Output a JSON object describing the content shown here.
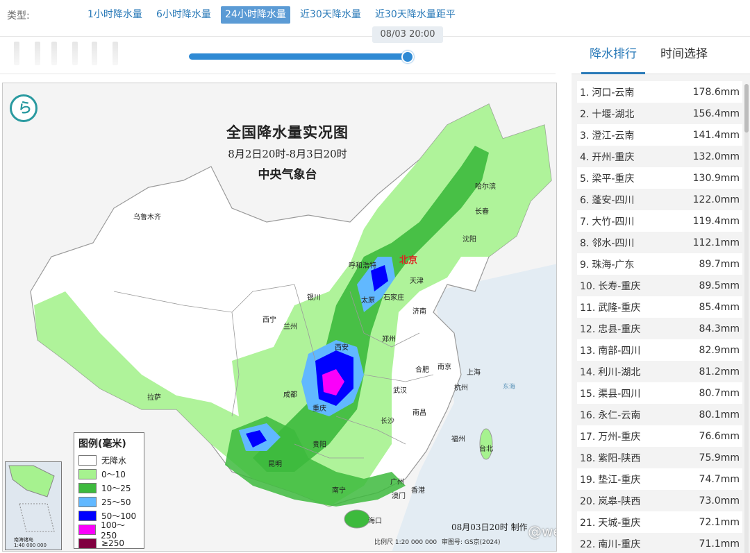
{
  "type_bar": {
    "label": "类型:",
    "tabs": [
      "1小时降水量",
      "6小时降水量",
      "24小时降水量",
      "近30天降水量",
      "近30天降水量距平"
    ],
    "active_index": 2
  },
  "timeline": {
    "tooltip": "08/03 20:00",
    "position_fraction": 1.0
  },
  "map": {
    "title": "全国降水量实况图",
    "subtitle": "8月2日20时-8月3日20时",
    "agency": "中央气象台",
    "capital": "北京",
    "cities": [
      "乌鲁木齐",
      "哈尔滨",
      "长春",
      "沈阳",
      "呼和浩特",
      "天津",
      "石家庄",
      "太原",
      "银川",
      "济南",
      "西宁",
      "兰州",
      "郑州",
      "西安",
      "合肥",
      "南京",
      "上海",
      "成都",
      "重庆",
      "武汉",
      "杭州",
      "拉萨",
      "长沙",
      "南昌",
      "贵阳",
      "福州",
      "台北",
      "昆明",
      "南宁",
      "广州",
      "香港",
      "澳门",
      "海口"
    ],
    "legend": {
      "title": "图例(毫米)",
      "items": [
        {
          "label": "无降水",
          "color": "#ffffff"
        },
        {
          "label": "0～10",
          "color": "#a6f28f"
        },
        {
          "label": "10～25",
          "color": "#3dba3d"
        },
        {
          "label": "25～50",
          "color": "#61b8ff"
        },
        {
          "label": "50～100",
          "color": "#0000ff"
        },
        {
          "label": "100～250",
          "color": "#fa00fa"
        },
        {
          "label": "≥250",
          "color": "#800040"
        }
      ]
    },
    "inset_label": "南海诸岛\n1:40 000 000",
    "production_note": "08月03日20时 制作",
    "scale_note": "比例尺 1:20 000 000",
    "review_note": "审图号: GS京(2024)",
    "sea_label": "东海",
    "watermark": "@weatherman_信欣"
  },
  "ranking": {
    "tabs": [
      "降水排行",
      "时间选择"
    ],
    "active_index": 0,
    "rows": [
      {
        "rank": "1.",
        "place": "河口-云南",
        "value": "178.6mm"
      },
      {
        "rank": "2.",
        "place": "十堰-湖北",
        "value": "156.4mm"
      },
      {
        "rank": "3.",
        "place": "澄江-云南",
        "value": "141.4mm"
      },
      {
        "rank": "4.",
        "place": "开州-重庆",
        "value": "132.0mm"
      },
      {
        "rank": "5.",
        "place": "梁平-重庆",
        "value": "130.9mm"
      },
      {
        "rank": "6.",
        "place": "蓬安-四川",
        "value": "122.0mm"
      },
      {
        "rank": "7.",
        "place": "大竹-四川",
        "value": "119.4mm"
      },
      {
        "rank": "8.",
        "place": "邻水-四川",
        "value": "112.1mm"
      },
      {
        "rank": "9.",
        "place": "珠海-广东",
        "value": "89.7mm"
      },
      {
        "rank": "10.",
        "place": "长寿-重庆",
        "value": "89.5mm"
      },
      {
        "rank": "11.",
        "place": "武隆-重庆",
        "value": "85.4mm"
      },
      {
        "rank": "12.",
        "place": "忠县-重庆",
        "value": "84.3mm"
      },
      {
        "rank": "13.",
        "place": "南部-四川",
        "value": "82.9mm"
      },
      {
        "rank": "14.",
        "place": "利川-湖北",
        "value": "81.2mm"
      },
      {
        "rank": "15.",
        "place": "渠县-四川",
        "value": "80.7mm"
      },
      {
        "rank": "16.",
        "place": "永仁-云南",
        "value": "80.1mm"
      },
      {
        "rank": "17.",
        "place": "万州-重庆",
        "value": "76.6mm"
      },
      {
        "rank": "18.",
        "place": "紫阳-陕西",
        "value": "75.9mm"
      },
      {
        "rank": "19.",
        "place": "垫江-重庆",
        "value": "74.7mm"
      },
      {
        "rank": "20.",
        "place": "岚皋-陕西",
        "value": "73.0mm"
      },
      {
        "rank": "21.",
        "place": "天城-重庆",
        "value": "72.1mm"
      },
      {
        "rank": "22.",
        "place": "南川-重庆",
        "value": "71.1mm"
      }
    ]
  }
}
